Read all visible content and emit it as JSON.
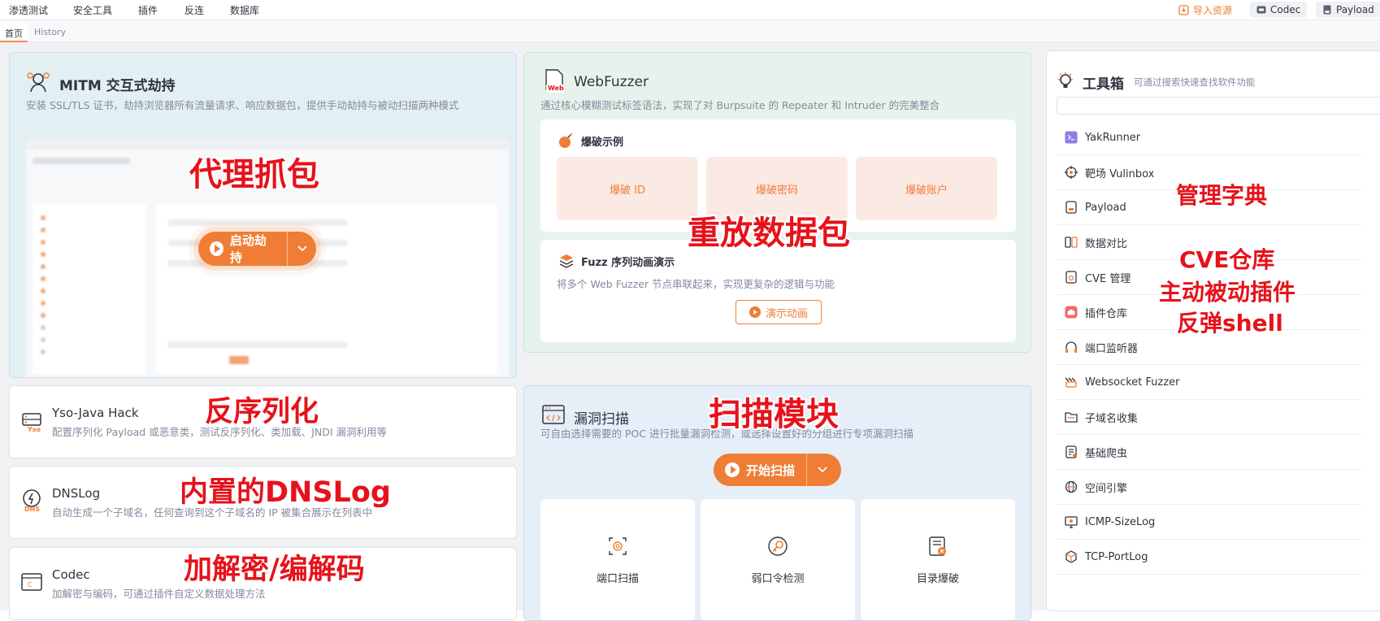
{
  "menubar": {
    "items": [
      "渗透测试",
      "安全工具",
      "插件",
      "反连",
      "数据库"
    ],
    "import_label": "导入资源",
    "codec_label": "Codec",
    "payload_label": "Payload"
  },
  "tabs": [
    "首页",
    "History"
  ],
  "mitm": {
    "title": "MITM 交互式劫持",
    "desc": "安装 SSL/TLS 证书，劫持浏览器所有流量请求、响应数据包，提供手动劫持与被动扫描两种模式",
    "button_label": "启动劫持"
  },
  "webfuzzer": {
    "title": "WebFuzzer",
    "desc": "通过核心模糊测试标签语法，实现了对 Burpsuite 的 Repeater 和 Intruder 的完美整合",
    "icon_text": "Web",
    "burst": {
      "title": "爆破示例",
      "items": [
        "爆破 ID",
        "爆破密码",
        "爆破账户"
      ]
    },
    "fuzz_seq": {
      "title": "Fuzz 序列动画演示",
      "desc": "将多个 Web Fuzzer 节点串联起来，实现更复杂的逻辑与功能",
      "button_label": "演示动画"
    }
  },
  "yso": {
    "title": "Yso-Java Hack",
    "desc": "配置序列化 Payload 或恶意类，测试反序列化、类加载、JNDI 漏洞利用等",
    "icon_text": "Yso"
  },
  "dnslog": {
    "title": "DNSLog",
    "desc": "自动生成一个子域名，任何查询到这个子域名的 IP 被集合展示在列表中",
    "icon_text": "DNS"
  },
  "codec": {
    "title": "Codec",
    "desc": "加解密与编码，可通过插件自定义数据处理方法"
  },
  "vuln": {
    "title": "漏洞扫描",
    "desc": "可自由选择需要的 POC 进行批量漏洞检测，或选择设置好的分组进行专项漏洞扫描",
    "button_label": "开始扫描",
    "items": [
      "端口扫描",
      "弱口令检测",
      "目录爆破"
    ]
  },
  "toolbox": {
    "title": "工具箱",
    "subtitle": "可通过搜索快速查找软件功能",
    "search_placeholder": "",
    "tools": [
      "YakRunner",
      "靶场 Vulinbox",
      "Payload",
      "数据对比",
      "CVE 管理",
      "插件仓库",
      "端口监听器",
      "Websocket Fuzzer",
      "子域名收集",
      "基础爬虫",
      "空间引擎",
      "ICMP-SizeLog",
      "TCP-PortLog"
    ]
  },
  "annotations": {
    "proxy": "代理抓包",
    "replay": "重放数据包",
    "deserialize": "反序列化",
    "dnslog": "内置的DNSLog",
    "codec": "加解密/编解码",
    "scan": "扫描模块",
    "dict": "管理字典",
    "cve": "CVE仓库",
    "plugins": "主动被动插件",
    "shell": "反弹shell"
  },
  "colors": {
    "accent": "#ef7d35",
    "annotation": "#e6121b",
    "mitm_bg": "#e3f0f3",
    "fuzzer_bg": "#e8f2ec",
    "vuln_bg": "#e6eef8"
  }
}
